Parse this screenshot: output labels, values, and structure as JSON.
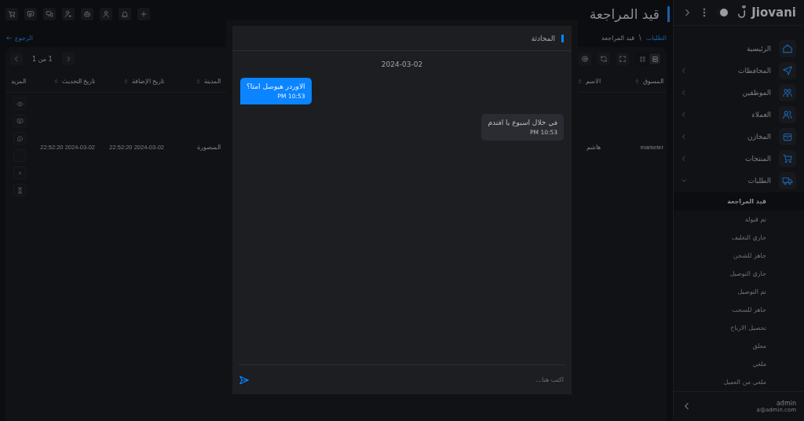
{
  "sidebar": {
    "logo": "Jiovani",
    "theme_toggle": {
      "on": true
    },
    "items": [
      {
        "label": "الرئيسية"
      },
      {
        "label": "المحافظات",
        "expanded": false
      },
      {
        "label": "الموظفين",
        "expanded": false
      },
      {
        "label": "العملاء",
        "expanded": false
      },
      {
        "label": "المخازن",
        "expanded": false
      },
      {
        "label": "المنتجات",
        "expanded": false
      },
      {
        "label": "الطلبات",
        "expanded": true,
        "children": [
          {
            "label": "قيد المراجعة",
            "selected": true
          },
          {
            "label": "تم قبولة",
            "selected": false
          },
          {
            "label": "جاري التغليف",
            "selected": false
          },
          {
            "label": "جاهز للشحن",
            "selected": false
          },
          {
            "label": "جاري التوصيل",
            "selected": false
          },
          {
            "label": "تم التوصيل",
            "selected": false
          },
          {
            "label": "جاهز للسحب",
            "selected": false
          },
          {
            "label": "تحصيل الارباح",
            "selected": false
          },
          {
            "label": "معلق",
            "selected": false
          },
          {
            "label": "ملغي",
            "selected": false
          },
          {
            "label": "ملغي من العميل",
            "selected": false
          }
        ]
      }
    ],
    "user": {
      "name": "admin",
      "email": "a@admin.com"
    }
  },
  "header": {
    "title": "قيد المراجعة"
  },
  "breadcrumb": [
    {
      "label": "الطلبات",
      "kind": "link"
    },
    {
      "label": "\\",
      "kind": "separator"
    },
    {
      "label": "قيد المراجعة",
      "kind": "current"
    }
  ],
  "back_link": "الرجوع",
  "table": {
    "views": [
      {
        "selected": true
      },
      {
        "selected": false
      }
    ],
    "pagination": "1 من 1",
    "columns": [
      "المسوق",
      "الاسم",
      "",
      "المدينة",
      "تاريخ الإضافة",
      "تاريخ التحديث",
      "المزيد"
    ],
    "rows": [
      {
        "cells": [
          "marketer",
          "هاشم",
          "",
          "المنصورة",
          "2024-03-02 22:52:20",
          "2024-03-02 22:52:20"
        ]
      }
    ]
  },
  "chat": {
    "title": "المحادثة",
    "date": "2024-03-02",
    "messages": [
      {
        "kind": "outgoing",
        "text": "الاوردر هيوصل امتا؟",
        "time": "10:53 PM"
      },
      {
        "kind": "incoming",
        "text": "في خلال اسبوع يا افندم",
        "time": "10:53 PM"
      }
    ],
    "input": {
      "placeholder": "اكتب هنا..."
    }
  }
}
